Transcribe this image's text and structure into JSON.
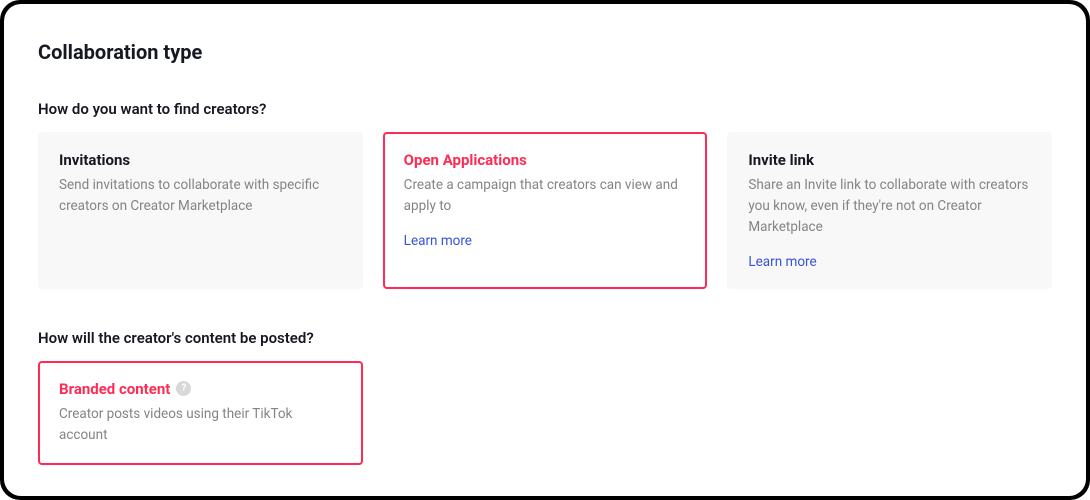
{
  "page_title": "Collaboration type",
  "section1": {
    "title": "How do you want to find creators?",
    "cards": [
      {
        "title": "Invitations",
        "desc": "Send invitations to collaborate with specific creators on Creator Marketplace"
      },
      {
        "title": "Open Applications",
        "desc": "Create a campaign that creators can view and apply to",
        "learn_more": "Learn more"
      },
      {
        "title": "Invite link",
        "desc": "Share an Invite link to collaborate with creators you know, even if they're not on Creator Marketplace",
        "learn_more": "Learn more"
      }
    ]
  },
  "section2": {
    "title": "How will the creator's content be posted?",
    "cards": [
      {
        "title": "Branded content",
        "desc": "Creator posts videos using their TikTok account"
      }
    ]
  },
  "help_glyph": "?"
}
